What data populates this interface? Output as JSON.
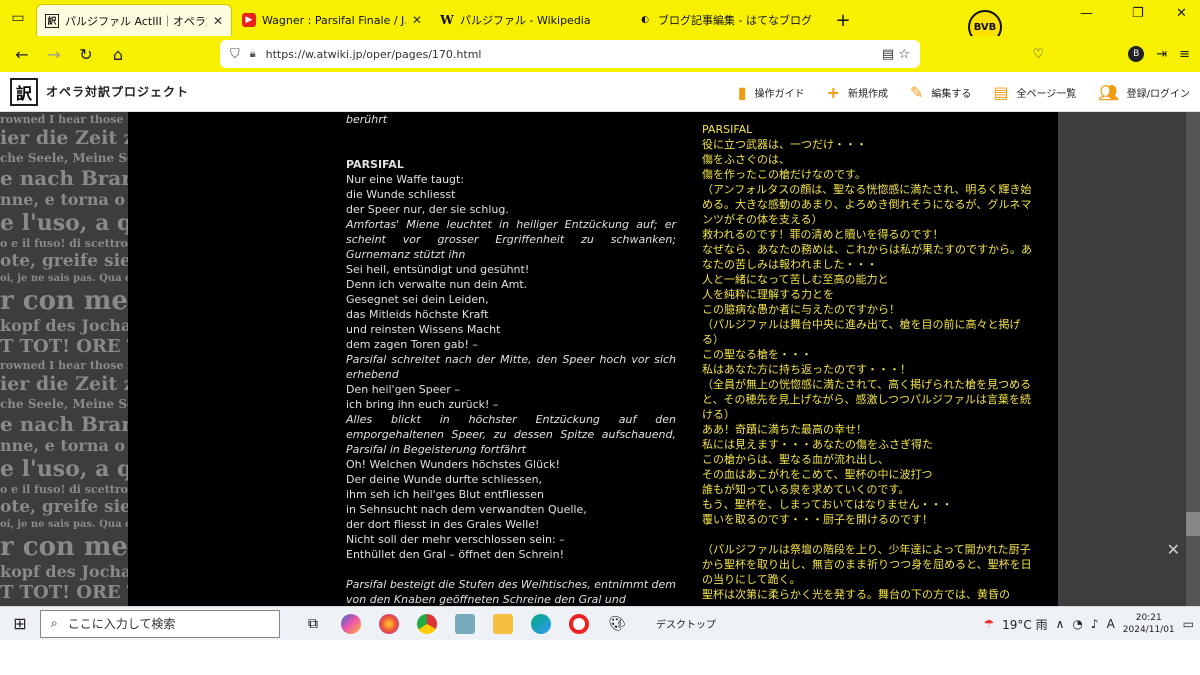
{
  "browser": {
    "tabs": [
      {
        "title": "パルジファル ActIII｜オペラ対訳プロ",
        "active": true,
        "favicon": "訳"
      },
      {
        "title": "Wagner : Parsifal Finale / J.Levir",
        "active": false,
        "favicon": "▶"
      },
      {
        "title": "パルジファル - Wikipedia",
        "active": false,
        "favicon": "W"
      },
      {
        "title": "ブログ記事編集 - はてなブログ",
        "active": false,
        "favicon": "◐"
      }
    ],
    "url": "https://w.atwiki.jp/oper/pages/170.html",
    "avatar_letter": "B",
    "bvb_text": "BVB"
  },
  "site": {
    "logo": "訳",
    "name": "オペラ対訳プロジェクト",
    "menu": [
      "操作ガイド",
      "新規作成",
      "編集する",
      "全ページ一覧",
      "登録/ログイン"
    ]
  },
  "german": {
    "lines": [
      {
        "t": "berührt",
        "style": "it"
      },
      {
        "t": "",
        "style": ""
      },
      {
        "t": "",
        "style": ""
      },
      {
        "t": "PARSIFAL",
        "style": "b"
      },
      {
        "t": "Nur eine Waffe taugt:",
        "style": ""
      },
      {
        "t": "die Wunde schliesst",
        "style": ""
      },
      {
        "t": "der Speer nur, der sie schlug.",
        "style": ""
      },
      {
        "t": "Amfortas' Miene leuchtet in heiliger Entzückung auf; er scheint vor grosser Ergriffenheit zu schwanken; Gurnemanz stützt ihn",
        "style": "it"
      },
      {
        "t": "Sei heil, entsündigt und gesühnt!",
        "style": ""
      },
      {
        "t": "Denn ich verwalte nun dein Amt.",
        "style": ""
      },
      {
        "t": "Gesegnet sei dein Leiden,",
        "style": ""
      },
      {
        "t": "das Mitleids höchste Kraft",
        "style": ""
      },
      {
        "t": "und reinsten Wissens Macht",
        "style": ""
      },
      {
        "t": "dem zagen Toren gab! –",
        "style": ""
      },
      {
        "t": "Parsifal schreitet nach der Mitte, den Speer hoch vor sich erhebend",
        "style": "it"
      },
      {
        "t": "Den heil'gen Speer –",
        "style": ""
      },
      {
        "t": "ich bring ihn euch zurück! –",
        "style": ""
      },
      {
        "t": "Alles blickt in höchster Entzückung auf den emporgehaltenen Speer, zu dessen Spitze aufschauend, Parsifal in Begeisterung fortfährt",
        "style": "it"
      },
      {
        "t": "Oh! Welchen Wunders höchstes Glück!",
        "style": ""
      },
      {
        "t": "Der deine Wunde durfte schliessen,",
        "style": ""
      },
      {
        "t": "ihm seh ich heil'ges Blut entfliessen",
        "style": ""
      },
      {
        "t": "in Sehnsucht nach dem verwandten Quelle,",
        "style": ""
      },
      {
        "t": "der dort fliesst in des Grales Welle!",
        "style": ""
      },
      {
        "t": "Nicht soll der mehr verschlossen sein: –",
        "style": ""
      },
      {
        "t": "Enthüllet den Gral – öffnet den Schrein!",
        "style": ""
      },
      {
        "t": "",
        "style": ""
      },
      {
        "t": "Parsifal besteigt die Stufen des Weihtisches, entnimmt dem von den Knaben geöffneten Schreine den Gral und",
        "style": "it"
      }
    ]
  },
  "japanese": {
    "lines": [
      "PARSIFAL",
      "役に立つ武器は、一つだけ・・・",
      "傷をふさぐのは、",
      "傷を作ったこの槍だけなのです。",
      "（アンフォルタスの顔は、聖なる恍惚感に満たされ、明るく輝き始める。大きな感動のあまり、よろめき倒れそうになるが、グルネマンツがその体を支える）",
      "救われるのです！罪の清めと贖いを得るのです！",
      "なぜなら、あなたの務めは、これからは私が果たすのですから。あなたの苦しみは報われました・・・",
      "人と一緒になって苦しむ至高の能力と",
      "人を純粋に理解する力とを",
      "この臆病な愚か者に与えたのですから！",
      "（パルジファルは舞台中央に進み出て、槍を目の前に高々と掲げる）",
      "この聖なる槍を・・・",
      "私はあなた方に持ち返ったのです・・・！",
      "（全員が無上の恍惚感に満たされて、高く掲げられた槍を見つめると、その穂先を見上げながら、感激しつつパルジファルは言葉を続ける）",
      "ああ！奇蹟に満ちた最高の幸せ！",
      "私には見えます・・・あなたの傷をふさぎ得た",
      "この槍からは、聖なる血が流れ出し、",
      "その血はあこがれをこめて、聖杯の中に波打つ",
      "誰もが知っている泉を求めていくのです。",
      "もう、聖杯を、しまっておいてはなりません・・・",
      "覆いを取るのです・・・厨子を開けるのです！",
      "",
      "（パルジファルは祭壇の階段を上り、少年達によって開かれた厨子から聖杯を取り出し、無言のまま祈りつつ身を屈めると、聖杯を日の当りにして跪く。",
      "聖杯は次第に柔らかく光を発する。舞台の下の方では、黄昏の"
    ]
  },
  "pattern": {
    "rows": [
      "rowned   I hear those",
      "ier die Zeit zu",
      "che Seele,  Meine Se",
      "e nach Brannt",
      "nne, e torna o",
      "e l'uso, a qu",
      "o e il fuso! di scettro",
      "ote, greife sie ra",
      "oi, je ne sais pas. Qua",
      "r con me!  I",
      "kopf des Jochar",
      "T  TOT! ORE"
    ]
  },
  "taskbar": {
    "search_placeholder": "ここに入力して検索",
    "desktop_label": "デスクトップ",
    "weather": "19°C  雨",
    "time": "20:21",
    "date": "2024/11/01",
    "ime": "A"
  }
}
